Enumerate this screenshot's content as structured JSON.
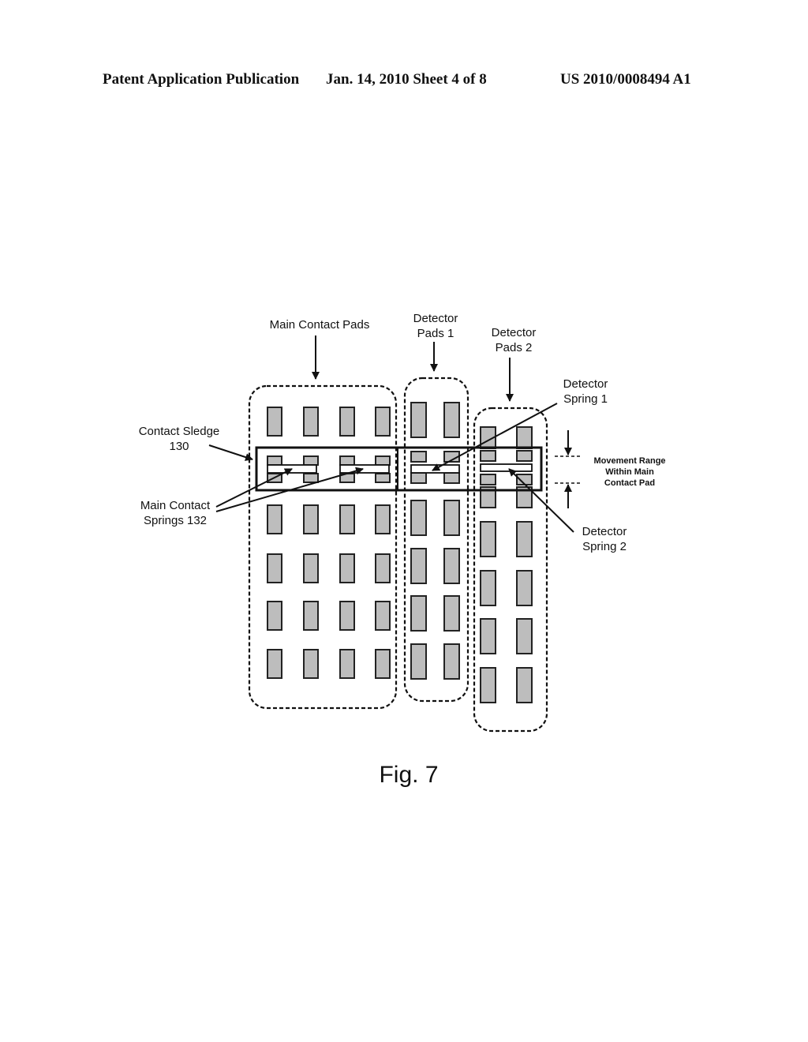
{
  "header": {
    "left": "Patent Application Publication",
    "middle": "Jan. 14, 2010  Sheet 4 of 8",
    "right": "US 2010/0008494 A1"
  },
  "figure": {
    "caption": "Fig. 7",
    "labels": {
      "main_contact_pads": "Main Contact Pads",
      "detector_pads_1": [
        "Detector",
        "Pads 1"
      ],
      "detector_pads_2": [
        "Detector",
        "Pads 2"
      ],
      "detector_spring_1": [
        "Detector",
        "Spring 1"
      ],
      "detector_spring_2": [
        "Detector",
        "Spring 2"
      ],
      "contact_sledge": [
        "Contact Sledge",
        "130"
      ],
      "main_contact_springs": [
        "Main Contact",
        "Springs 132"
      ],
      "movement_range": [
        "Movement Range",
        "Within Main",
        "Contact Pad"
      ]
    },
    "pad_groups": {
      "main_contact_pads": {
        "columns": 4,
        "rows": 6
      },
      "detector_pads_1": {
        "columns": 2,
        "rows": 6
      },
      "detector_pads_2": {
        "columns": 2,
        "rows": 6
      }
    }
  }
}
